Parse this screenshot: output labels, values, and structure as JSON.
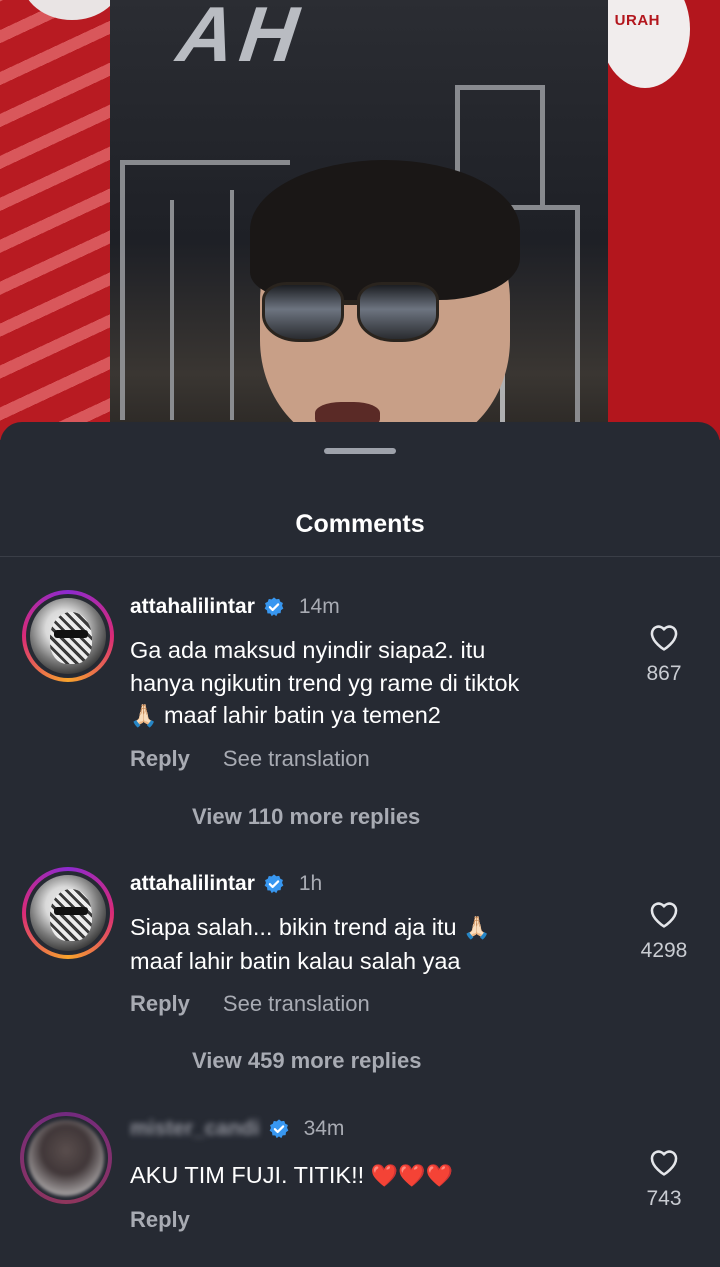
{
  "video": {
    "circle_right_text": "URAH"
  },
  "sheet": {
    "title": "Comments"
  },
  "comments": [
    {
      "username": "attahalilintar",
      "verified": true,
      "time": "14m",
      "text_line1": "Ga ada maksud nyindir siapa2. itu",
      "text_line2": "hanya ngikutin trend yg rame di tiktok",
      "text_line3_emoji": "🙏🏻",
      "text_line3": "maaf lahir batin ya temen2",
      "reply_label": "Reply",
      "translate_label": "See translation",
      "view_replies": "View 110 more replies",
      "likes": "867"
    },
    {
      "username": "attahalilintar",
      "verified": true,
      "time": "1h",
      "text_line1": "Siapa salah... bikin trend aja itu",
      "text_line1_emoji": "🙏🏻",
      "text_line2": "maaf lahir batin kalau salah yaa",
      "reply_label": "Reply",
      "translate_label": "See translation",
      "view_replies": "View 459 more replies",
      "likes": "4298"
    },
    {
      "username": "mister_candi",
      "verified": true,
      "time": "34m",
      "text": "AKU TIM FUJI. TITIK!!",
      "text_emoji": "❤️❤️❤️",
      "reply_label": "Reply",
      "likes": "743"
    }
  ],
  "icons": {
    "like": "heart-outline-icon",
    "verified": "verified-badge-icon"
  },
  "colors": {
    "sheet_bg": "#262a33",
    "verified_blue": "#3897f0",
    "muted_text": "#a8abb3",
    "backdrop_red": "#b81b22"
  }
}
